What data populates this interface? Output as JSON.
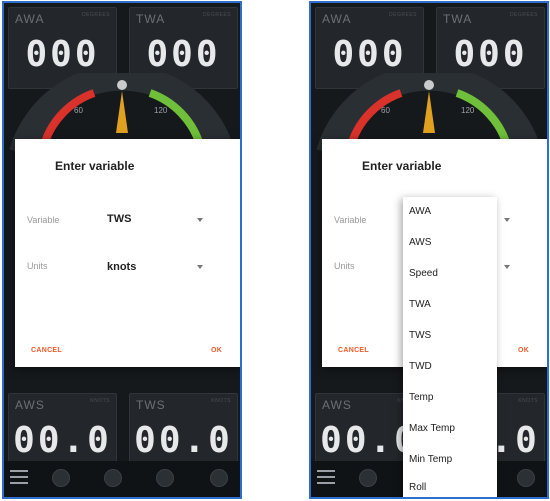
{
  "tiles": {
    "awa": {
      "label": "AWA",
      "unit": "DEGREES",
      "value": "000"
    },
    "twa": {
      "label": "TWA",
      "unit": "DEGREES",
      "value": "000"
    },
    "aws": {
      "label": "AWS",
      "unit": "KNOTS",
      "value": "00.0"
    },
    "tws": {
      "label": "TWS",
      "unit": "KNOTS",
      "value": "00.0"
    }
  },
  "gauge": {
    "tick_60": "60",
    "tick_120": "120"
  },
  "dialog": {
    "title": "Enter variable",
    "variable_label": "Variable",
    "variable_value": "TWS",
    "units_label": "Units",
    "units_value": "knots",
    "cancel": "CANCEL",
    "ok": "OK"
  },
  "dropdown": {
    "items": [
      "AWA",
      "AWS",
      "Speed",
      "TWA",
      "TWS",
      "TWD",
      "Temp",
      "Max Temp",
      "Min Temp",
      "Roll"
    ]
  },
  "colors": {
    "accent": "#f05a28",
    "frame": "#2f6fc9",
    "port": "#d9322b",
    "starboard": "#6fbf3a",
    "needle": "#e0a020"
  }
}
